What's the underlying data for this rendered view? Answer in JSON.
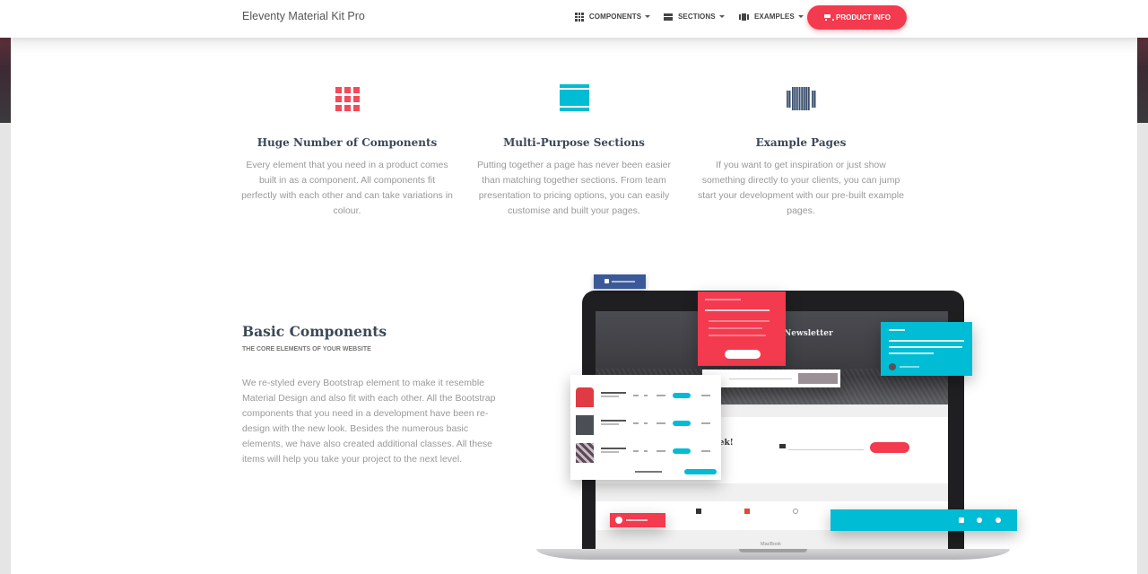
{
  "navbar": {
    "brand": "Eleventy Material Kit Pro",
    "items": [
      {
        "label": "Components",
        "icon": "apps-icon"
      },
      {
        "label": "Sections",
        "icon": "sections-icon"
      },
      {
        "label": "Examples",
        "icon": "examples-icon"
      }
    ],
    "cta": {
      "label": "Product Info",
      "icon": "shopping-cart-icon"
    }
  },
  "features": [
    {
      "icon": "apps-grid-icon",
      "title": "Huge Number of Components",
      "description": "Every element that you need in a product comes built in as a component. All components fit perfectly with each other and can take variations in colour."
    },
    {
      "icon": "view-day-icon",
      "title": "Multi-Purpose Sections",
      "description": "Putting together a page has never been easier than matching together sections. From team presentation to pricing options, you can easily customise and built your pages."
    },
    {
      "icon": "view-carousel-icon",
      "title": "Example Pages",
      "description": "If you want to get inspiration or just show something directly to your clients, you can jump start your development with our pre-built example pages."
    }
  ],
  "basic_components": {
    "title": "Basic Components",
    "subtitle": "The core elements of your website",
    "description": "We re-styled every Bootstrap element to make it resemble Material Design and also fit with each other. All the Bootstrap components that you need in a development have been re-design with the new look. Besides the numerous basic elements, we have also created additional classes. All these items will help you take your project to the next level."
  },
  "mockup": {
    "newsletter_heading": "Newsletter",
    "week_heading": "eek!",
    "laptop_label": "MacBook"
  },
  "colors": {
    "accent_red": "#f33a4f",
    "accent_cyan": "#00bcd4",
    "accent_blue": "#3c4f6a"
  }
}
